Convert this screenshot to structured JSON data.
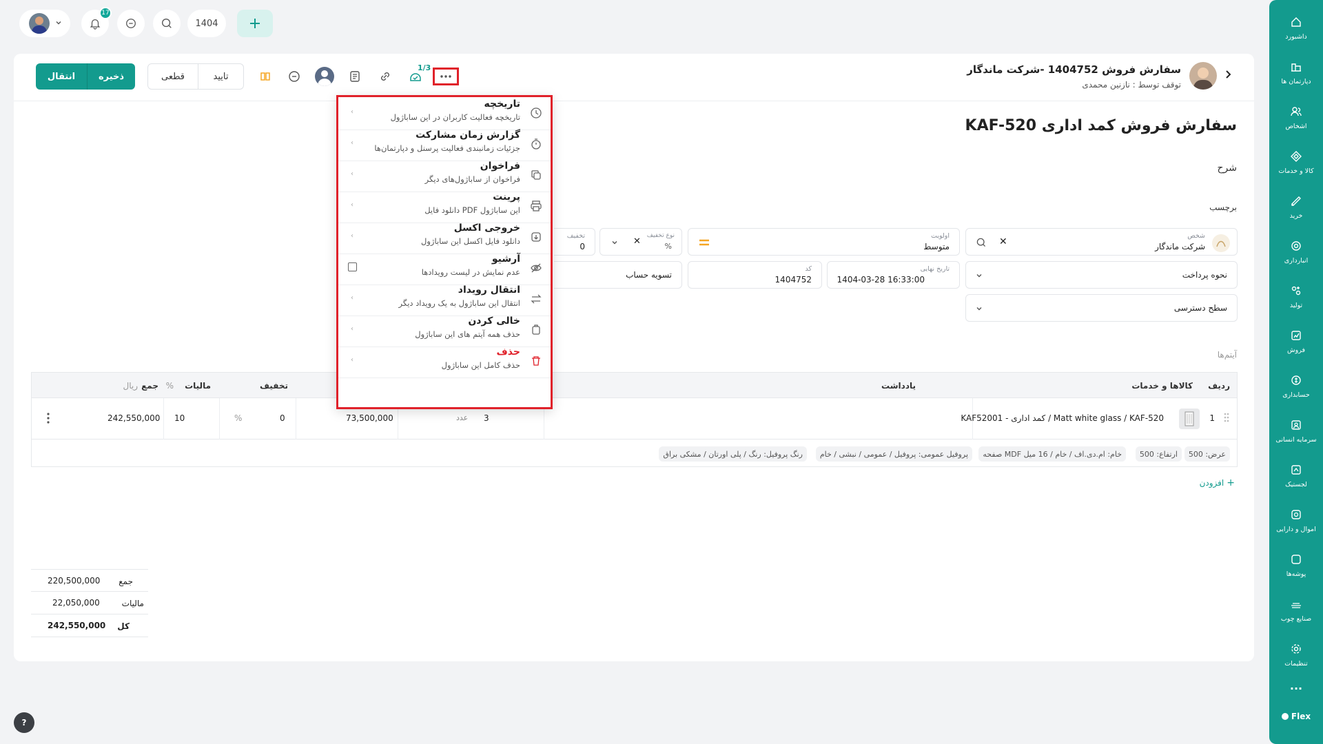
{
  "topbar": {
    "year": "1404",
    "notifications_count": "17"
  },
  "sidebar": {
    "items": [
      {
        "label": "داشبورد",
        "icon": "home-icon"
      },
      {
        "label": "دپارتمان ها",
        "icon": "building-icon"
      },
      {
        "label": "اشخاص",
        "icon": "users-icon"
      },
      {
        "label": "کالا و خدمات",
        "icon": "box-icon"
      },
      {
        "label": "خرید",
        "icon": "cart-icon"
      },
      {
        "label": "انبارداری",
        "icon": "warehouse-icon"
      },
      {
        "label": "تولید",
        "icon": "factory-icon"
      },
      {
        "label": "فروش",
        "icon": "chart-icon"
      },
      {
        "label": "حسابداری",
        "icon": "coin-icon"
      },
      {
        "label": "سرمایه انسانی",
        "icon": "person-icon"
      },
      {
        "label": "لجستیک",
        "icon": "truck-icon"
      },
      {
        "label": "اموال و دارایی",
        "icon": "asset-icon"
      },
      {
        "label": "پوشه‌ها",
        "icon": "folder-icon"
      },
      {
        "label": "صنایع چوب",
        "icon": "wood-icon"
      },
      {
        "label": "تنظیمات",
        "icon": "gear-icon"
      }
    ],
    "more": "...",
    "brand": "Flex"
  },
  "header": {
    "title": "سفارش فروش 1404752 -شرکت ماندگار",
    "subtitle": "توقف توسط : نازنین محمدی",
    "stage_counter": "1/3",
    "buttons": {
      "transfer": "انتقال",
      "save": "ذخیره",
      "final": "قطعی",
      "confirm": "تایید"
    }
  },
  "form": {
    "page_title": "سفارش فروش کمد اداری KAF-520",
    "description_label": "شرح",
    "tag_label": "برچسب",
    "person_label": "شخص",
    "person_value": "شرکت ماندگار",
    "priority_label": "اولویت",
    "priority_value": "متوسط",
    "discount_type_label": "نوع تخفیف",
    "discount_type_value": "%",
    "discount_label": "تخفیف",
    "discount_value": "0",
    "payment_label": "نحوه پرداخت",
    "deadline_label": "تاریخ نهایی",
    "deadline_value": "1404-03-28 16:33:00",
    "code_label": "کد",
    "code_value": "1404752",
    "settlement": "تسویه حساب",
    "access_label": "سطح دسترسی",
    "items_label": "آیتم‌ها"
  },
  "table": {
    "headers": {
      "row": "ردیف",
      "product": "کالاها و خدمات",
      "note": "یادداشت",
      "discount": "تخفیف",
      "tax": "مالیات",
      "tax_unit": "%",
      "total": "جمع",
      "total_unit": "ریال"
    },
    "row": {
      "index": "1",
      "product": "KAF52001 - کمد اداری / Matt white glass / KAF-520",
      "qty": "3",
      "unit": "عدد",
      "price": "73,500,000",
      "discount": "0",
      "discount_unit": "%",
      "tax": "10",
      "total": "242,550,000"
    },
    "chips": [
      "عرض: 500",
      "ارتفاع: 500",
      "صفحه MDF خام: ام.دی.اف / خام / 16 میل",
      "پروفیل عمومی: پروفیل / عمومی / نبشی / خام",
      "رنگ پروفیل: رنگ / پلی اورتان / مشکی براق"
    ],
    "add_label": "افزودن"
  },
  "totals": {
    "sum_label": "جمع",
    "sum_value": "220,500,000",
    "tax_label": "مالیات",
    "tax_value": "22,050,000",
    "total_label": "کل",
    "total_value": "242,550,000"
  },
  "menu": {
    "items": [
      {
        "title": "تاریخچه",
        "sub": "تاریخچه فعالیت کاربران در این ساباژول",
        "icon": "clock-icon"
      },
      {
        "title": "گزارش زمان مشارکت",
        "sub": "جزئیات زمانبندی فعالیت پرسنل و دپارتمان‌ها",
        "icon": "stopwatch-icon"
      },
      {
        "title": "فراخوان",
        "sub": "فراخوان از ساباژول‌های دیگر",
        "icon": "copy-icon"
      },
      {
        "title": "پرینت",
        "sub": "دانلود فایل PDF این ساباژول",
        "icon": "printer-icon"
      },
      {
        "title": "خروجی اکسل",
        "sub": "دانلود فایل اکسل این ساباژول",
        "icon": "download-icon"
      },
      {
        "title": "آرشیو",
        "sub": "عدم نمایش در لیست رویدادها",
        "icon": "eye-off-icon"
      },
      {
        "title": "انتقال رویداد",
        "sub": "انتقال این ساباژول به یک رویداد دیگر",
        "icon": "transfer-icon"
      },
      {
        "title": "خالی کردن",
        "sub": "حذف همه آیتم های این ساباژول",
        "icon": "clear-icon"
      },
      {
        "title": "حذف",
        "sub": "حذف کامل این ساباژول",
        "icon": "trash-icon"
      }
    ]
  },
  "colors": {
    "accent": "#139b8e",
    "danger": "#e0212a",
    "warning": "#f5a623"
  }
}
